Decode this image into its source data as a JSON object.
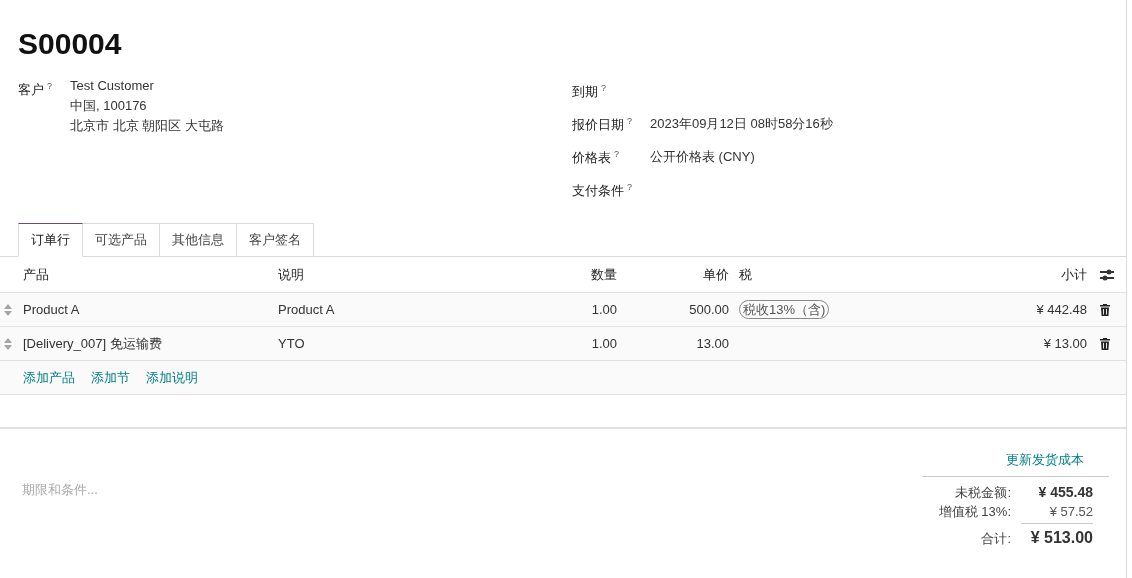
{
  "title": "S00004",
  "customer": {
    "label": "客户",
    "help": "?",
    "lines": [
      "Test Customer",
      "中国, 100176",
      "北京市 北京 朝阳区 大屯路"
    ]
  },
  "fields": [
    {
      "label": "到期",
      "help": "?"
    },
    {
      "label": "报价日期",
      "help": "?",
      "value": "2023年09月12日 08时58分16秒"
    },
    {
      "label": "价格表",
      "help": "?",
      "value": "公开价格表 (CNY)"
    },
    {
      "label": "支付条件",
      "help": "?"
    }
  ],
  "tabs": [
    {
      "label": "订单行",
      "selected": true
    },
    {
      "label": "可选产品",
      "selected": false
    },
    {
      "label": "其他信息",
      "selected": false
    },
    {
      "label": "客户签名",
      "selected": false
    }
  ],
  "table": {
    "columns": [
      "产品",
      "说明",
      "数量",
      "单价",
      "税",
      "小计"
    ],
    "rows": [
      {
        "product": "Product A",
        "description": "Product A",
        "quantity": "1.00",
        "unit_price": "500.00",
        "taxes": [
          "税收13%（含)"
        ],
        "subtotal": "¥ 442.48"
      },
      {
        "product": "[Delivery_007] 免运输费",
        "description": "YTO",
        "quantity": "1.00",
        "unit_price": "13.00",
        "taxes": [],
        "subtotal": "¥ 13.00"
      }
    ],
    "add_links": [
      "添加产品",
      "添加节",
      "添加说明"
    ]
  },
  "notes": {
    "placeholder": "期限和条件..."
  },
  "update_shipping": "更新发货成本",
  "totals": [
    {
      "kind": "untaxed",
      "label": "未税金额:",
      "value": "¥ 455.48"
    },
    {
      "kind": "tax",
      "label": "增值税 13%:",
      "value": "¥ 57.52"
    },
    {
      "kind": "total",
      "label": "合计:",
      "value": "¥ 513.00"
    }
  ]
}
